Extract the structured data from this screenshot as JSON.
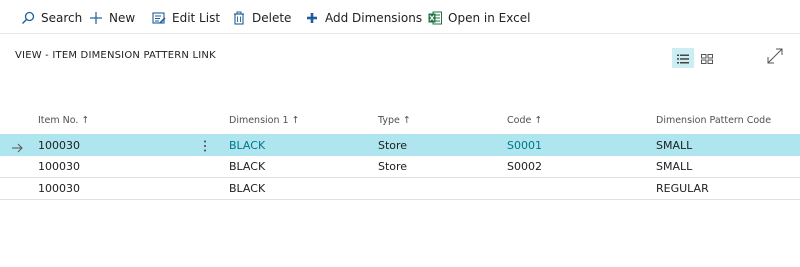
{
  "toolbar": {
    "search": {
      "label": "Search",
      "icon": "search-icon"
    },
    "new": {
      "label": "New",
      "icon": "plus-icon"
    },
    "edit_list": {
      "label": "Edit List",
      "icon": "edit-list-icon"
    },
    "delete": {
      "label": "Delete",
      "icon": "trash-icon"
    },
    "add_dimensions": {
      "label": "Add Dimensions",
      "icon": "plus-bold-icon"
    },
    "open_excel": {
      "label": "Open in Excel",
      "icon": "excel-icon"
    }
  },
  "view": {
    "title": "VIEW - ITEM DIMENSION PATTERN LINK",
    "list_view_icon": "list-view-icon",
    "tile_view_icon": "tile-view-icon",
    "expand_icon": "expand-icon"
  },
  "table": {
    "headers": [
      "Item No. ↑",
      "Dimension 1 ↑",
      "Type ↑",
      "Code ↑",
      "Dimension Pattern Code"
    ],
    "rows": [
      {
        "item_no": "100030",
        "dimension_1": "BLACK",
        "type": "Store",
        "code": "S0001",
        "pattern_code": "SMALL",
        "selected": true
      },
      {
        "item_no": "100030",
        "dimension_1": "BLACK",
        "type": "Store",
        "code": "S0002",
        "pattern_code": "SMALL",
        "selected": false
      },
      {
        "item_no": "100030",
        "dimension_1": "BLACK",
        "type": "",
        "code": "",
        "pattern_code": "REGULAR",
        "selected": false
      }
    ]
  },
  "colors": {
    "accent": "#00768a",
    "selected_row": "#aee5ee",
    "active_view": "#cceef3",
    "excel_green": "#217346",
    "icon_blue": "#1e5f99"
  }
}
